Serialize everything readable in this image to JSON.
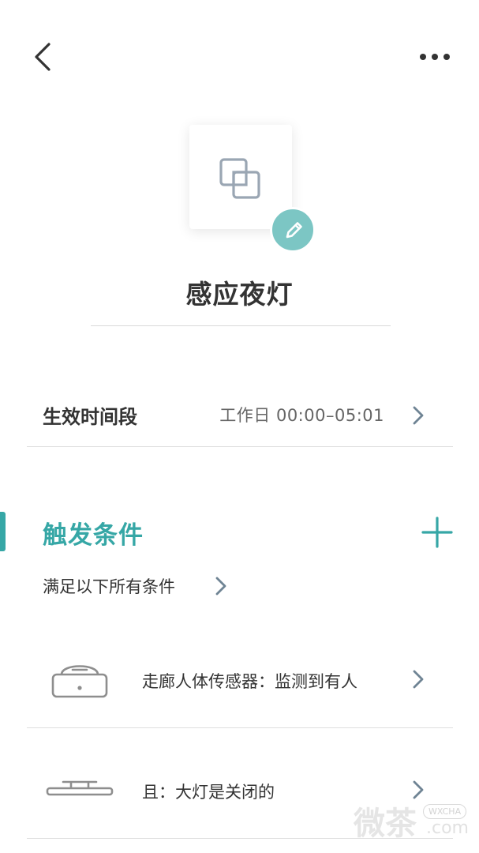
{
  "scene": {
    "name": "感应夜灯",
    "icon": "overlapping-squares-icon",
    "edit_icon": "pencil-icon"
  },
  "period": {
    "label": "生效时间段",
    "value": "工作日 00:00–05:01"
  },
  "triggers": {
    "title": "触发条件",
    "match_rule": "满足以下所有条件",
    "conditions": [
      {
        "device_icon": "motion-sensor-icon",
        "text": "走廊人体传感器：监测到有人"
      },
      {
        "device_icon": "ceiling-light-icon",
        "text": "且：大灯是关闭的"
      }
    ]
  },
  "watermark": {
    "text": "微茶",
    "sub": "WXCHA",
    "domain": ".com"
  },
  "colors": {
    "accent": "#36a7a6",
    "edit_button": "#7cc6c4",
    "chevron": "#6f8494",
    "icon_gray": "#8e8e8e"
  }
}
